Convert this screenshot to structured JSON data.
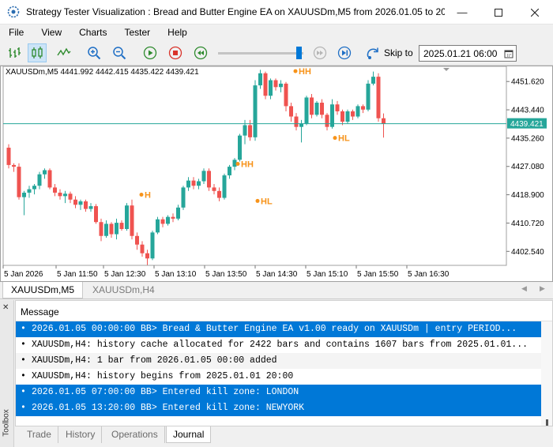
{
  "window": {
    "title": "Strategy Tester Visualization : Bread and Butter Engine EA on XAUUSDm,M5 from 2026.01.05 to 20..."
  },
  "menu": [
    "File",
    "View",
    "Charts",
    "Tester",
    "Help"
  ],
  "toolbar": {
    "skip_label": "Skip to",
    "skip_date": "2025.01.21 06:00",
    "speed_level": 0.92
  },
  "chart": {
    "symbol_info": "XAUUSDm,M5  4441.992 4442.415 4435.422 4439.421",
    "current_price": "4439.421",
    "price_labels": [
      "4451.620",
      "4443.440",
      "4435.260",
      "4427.080",
      "4418.900",
      "4410.720",
      "4402.540"
    ],
    "time_labels": [
      "5 Jan 2026",
      "5 Jan 11:50",
      "5 Jan 12:30",
      "5 Jan 13:10",
      "5 Jan 13:50",
      "5 Jan 14:30",
      "5 Jan 15:10",
      "5 Jan 15:50",
      "5 Jan 16:30"
    ],
    "swing_labels": [
      {
        "text": "H",
        "x": 183,
        "price": 4418.0
      },
      {
        "text": "HH",
        "x": 305,
        "price": 4426.9
      },
      {
        "text": "HL",
        "x": 330,
        "price": 4416.2
      },
      {
        "text": "HH",
        "x": 378,
        "price": 4453.7
      },
      {
        "text": "HL",
        "x": 428,
        "price": 4434.4
      }
    ],
    "colors": {
      "bull": "#26a69a",
      "bear": "#ef5350",
      "swing": "#f7931a",
      "price_line": "#26a69a"
    }
  },
  "chart_data": {
    "type": "candlestick",
    "ylim": [
      4398.5,
      4456.0
    ],
    "candles": [
      {
        "o": 4432.5,
        "h": 4433.5,
        "l": 4426.5,
        "c": 4427.5
      },
      {
        "o": 4427.5,
        "h": 4428.0,
        "l": 4425.5,
        "c": 4427.0
      },
      {
        "o": 4427.0,
        "h": 4428.0,
        "l": 4417.5,
        "c": 4418.2
      },
      {
        "o": 4418.2,
        "h": 4420.0,
        "l": 4413.0,
        "c": 4419.5
      },
      {
        "o": 4419.5,
        "h": 4421.5,
        "l": 4418.0,
        "c": 4420.5
      },
      {
        "o": 4420.5,
        "h": 4422.0,
        "l": 4419.0,
        "c": 4421.5
      },
      {
        "o": 4421.5,
        "h": 4425.5,
        "l": 4420.5,
        "c": 4424.8
      },
      {
        "o": 4424.8,
        "h": 4426.5,
        "l": 4423.5,
        "c": 4426.0
      },
      {
        "o": 4426.0,
        "h": 4426.5,
        "l": 4420.5,
        "c": 4421.0
      },
      {
        "o": 4421.0,
        "h": 4422.0,
        "l": 4418.5,
        "c": 4419.5
      },
      {
        "o": 4419.5,
        "h": 4420.5,
        "l": 4417.5,
        "c": 4418.5
      },
      {
        "o": 4418.5,
        "h": 4420.0,
        "l": 4416.5,
        "c": 4419.2
      },
      {
        "o": 4419.2,
        "h": 4419.8,
        "l": 4416.5,
        "c": 4417.5
      },
      {
        "o": 4417.5,
        "h": 4418.5,
        "l": 4415.0,
        "c": 4416.0
      },
      {
        "o": 4416.0,
        "h": 4417.5,
        "l": 4414.5,
        "c": 4417.0
      },
      {
        "o": 4417.0,
        "h": 4417.5,
        "l": 4414.0,
        "c": 4414.8
      },
      {
        "o": 4414.8,
        "h": 4416.5,
        "l": 4414.0,
        "c": 4415.6
      },
      {
        "o": 4415.6,
        "h": 4416.2,
        "l": 4410.5,
        "c": 4411.0
      },
      {
        "o": 4411.0,
        "h": 4412.0,
        "l": 4405.5,
        "c": 4407.0
      },
      {
        "o": 4407.0,
        "h": 4411.5,
        "l": 4406.5,
        "c": 4410.5
      },
      {
        "o": 4410.5,
        "h": 4411.0,
        "l": 4406.5,
        "c": 4407.5
      },
      {
        "o": 4407.5,
        "h": 4412.0,
        "l": 4406.0,
        "c": 4410.8
      },
      {
        "o": 4410.8,
        "h": 4411.5,
        "l": 4408.5,
        "c": 4409.0
      },
      {
        "o": 4409.0,
        "h": 4416.5,
        "l": 4408.5,
        "c": 4415.8
      },
      {
        "o": 4415.8,
        "h": 4417.5,
        "l": 4406.0,
        "c": 4407.0
      },
      {
        "o": 4407.0,
        "h": 4408.0,
        "l": 4403.0,
        "c": 4404.5
      },
      {
        "o": 4404.5,
        "h": 4405.5,
        "l": 4401.0,
        "c": 4402.0
      },
      {
        "o": 4402.0,
        "h": 4403.0,
        "l": 4398.6,
        "c": 4400.5
      },
      {
        "o": 4400.5,
        "h": 4408.5,
        "l": 4400.0,
        "c": 4408.0
      },
      {
        "o": 4408.0,
        "h": 4412.5,
        "l": 4407.5,
        "c": 4411.8
      },
      {
        "o": 4411.8,
        "h": 4412.5,
        "l": 4409.5,
        "c": 4410.5
      },
      {
        "o": 4410.5,
        "h": 4413.0,
        "l": 4410.0,
        "c": 4412.5
      },
      {
        "o": 4412.5,
        "h": 4413.5,
        "l": 4411.0,
        "c": 4412.0
      },
      {
        "o": 4412.0,
        "h": 4416.0,
        "l": 4411.5,
        "c": 4415.2
      },
      {
        "o": 4415.2,
        "h": 4421.5,
        "l": 4414.5,
        "c": 4421.0
      },
      {
        "o": 4421.0,
        "h": 4424.0,
        "l": 4420.0,
        "c": 4423.0
      },
      {
        "o": 4423.0,
        "h": 4424.0,
        "l": 4420.5,
        "c": 4421.5
      },
      {
        "o": 4421.5,
        "h": 4423.5,
        "l": 4420.5,
        "c": 4422.8
      },
      {
        "o": 4422.8,
        "h": 4426.5,
        "l": 4422.0,
        "c": 4425.8
      },
      {
        "o": 4425.8,
        "h": 4426.5,
        "l": 4420.0,
        "c": 4421.0
      },
      {
        "o": 4421.0,
        "h": 4422.0,
        "l": 4419.0,
        "c": 4420.0
      },
      {
        "o": 4420.0,
        "h": 4421.0,
        "l": 4417.0,
        "c": 4418.0
      },
      {
        "o": 4418.0,
        "h": 4425.0,
        "l": 4417.5,
        "c": 4424.5
      },
      {
        "o": 4424.5,
        "h": 4427.5,
        "l": 4423.5,
        "c": 4427.0
      },
      {
        "o": 4427.0,
        "h": 4429.5,
        "l": 4426.0,
        "c": 4429.0
      },
      {
        "o": 4429.0,
        "h": 4436.5,
        "l": 4428.5,
        "c": 4436.0
      },
      {
        "o": 4436.0,
        "h": 4440.5,
        "l": 4433.5,
        "c": 4439.0
      },
      {
        "o": 4439.0,
        "h": 4440.5,
        "l": 4434.5,
        "c": 4435.5
      },
      {
        "o": 4435.5,
        "h": 4452.0,
        "l": 4434.5,
        "c": 4450.5
      },
      {
        "o": 4450.5,
        "h": 4455.0,
        "l": 4449.5,
        "c": 4454.0
      },
      {
        "o": 4454.0,
        "h": 4454.5,
        "l": 4446.5,
        "c": 4447.5
      },
      {
        "o": 4447.5,
        "h": 4452.5,
        "l": 4446.5,
        "c": 4452.0
      },
      {
        "o": 4452.0,
        "h": 4452.5,
        "l": 4449.0,
        "c": 4450.0
      },
      {
        "o": 4450.0,
        "h": 4452.0,
        "l": 4448.5,
        "c": 4451.0
      },
      {
        "o": 4451.0,
        "h": 4451.5,
        "l": 4443.0,
        "c": 4444.5
      },
      {
        "o": 4444.5,
        "h": 4445.5,
        "l": 4440.0,
        "c": 4441.5
      },
      {
        "o": 4441.5,
        "h": 4442.5,
        "l": 4437.5,
        "c": 4438.5
      },
      {
        "o": 4438.5,
        "h": 4440.5,
        "l": 4434.0,
        "c": 4439.5
      },
      {
        "o": 4439.5,
        "h": 4447.5,
        "l": 4439.0,
        "c": 4447.0
      },
      {
        "o": 4447.0,
        "h": 4448.0,
        "l": 4441.0,
        "c": 4442.0
      },
      {
        "o": 4442.0,
        "h": 4446.0,
        "l": 4441.5,
        "c": 4445.5
      },
      {
        "o": 4445.5,
        "h": 4446.5,
        "l": 4441.0,
        "c": 4442.0
      },
      {
        "o": 4442.0,
        "h": 4442.5,
        "l": 4437.5,
        "c": 4438.5
      },
      {
        "o": 4438.5,
        "h": 4446.5,
        "l": 4438.0,
        "c": 4445.0
      },
      {
        "o": 4445.0,
        "h": 4446.0,
        "l": 4442.0,
        "c": 4443.0
      },
      {
        "o": 4443.0,
        "h": 4443.5,
        "l": 4439.0,
        "c": 4440.0
      },
      {
        "o": 4440.0,
        "h": 4443.5,
        "l": 4439.5,
        "c": 4443.0
      },
      {
        "o": 4443.0,
        "h": 4443.5,
        "l": 4440.5,
        "c": 4441.5
      },
      {
        "o": 4441.5,
        "h": 4445.0,
        "l": 4441.0,
        "c": 4444.5
      },
      {
        "o": 4444.5,
        "h": 4445.0,
        "l": 4442.5,
        "c": 4443.5
      },
      {
        "o": 4443.5,
        "h": 4452.0,
        "l": 4443.0,
        "c": 4451.0
      },
      {
        "o": 4451.0,
        "h": 4454.5,
        "l": 4450.5,
        "c": 4453.0
      },
      {
        "o": 4453.0,
        "h": 4454.0,
        "l": 4440.0,
        "c": 4441.0
      },
      {
        "o": 4441.0,
        "h": 4442.4,
        "l": 4435.4,
        "c": 4439.4
      }
    ]
  },
  "chart_tabs": [
    {
      "label": "XAUUSDm,M5",
      "active": true
    },
    {
      "label": "XAUUSDm,H4",
      "active": false
    }
  ],
  "toolbox": {
    "side_label": "Toolbox",
    "column_header": "Message",
    "messages": [
      {
        "text": "2026.01.05 00:00:00   BB> Bread & Butter Engine EA v1.00 ready on XAUUSDm | entry PERIOD...",
        "selected": true
      },
      {
        "text": "XAUUSDm,H4: history cache allocated for 2422 bars and contains 1607 bars from 2025.01.01...",
        "selected": false
      },
      {
        "text": "XAUUSDm,H4: 1 bar from 2026.01.05 00:00 added",
        "selected": false
      },
      {
        "text": "XAUUSDm,H4: history begins from 2025.01.01 20:00",
        "selected": false
      },
      {
        "text": "2026.01.05 07:00:00   BB> Entered kill zone: LONDON",
        "selected": true
      },
      {
        "text": "2026.01.05 13:20:00   BB> Entered kill zone: NEWYORK",
        "selected": true
      }
    ],
    "tabs": [
      "Trade",
      "History",
      "Operations",
      "Journal"
    ],
    "active_tab": "Journal"
  }
}
